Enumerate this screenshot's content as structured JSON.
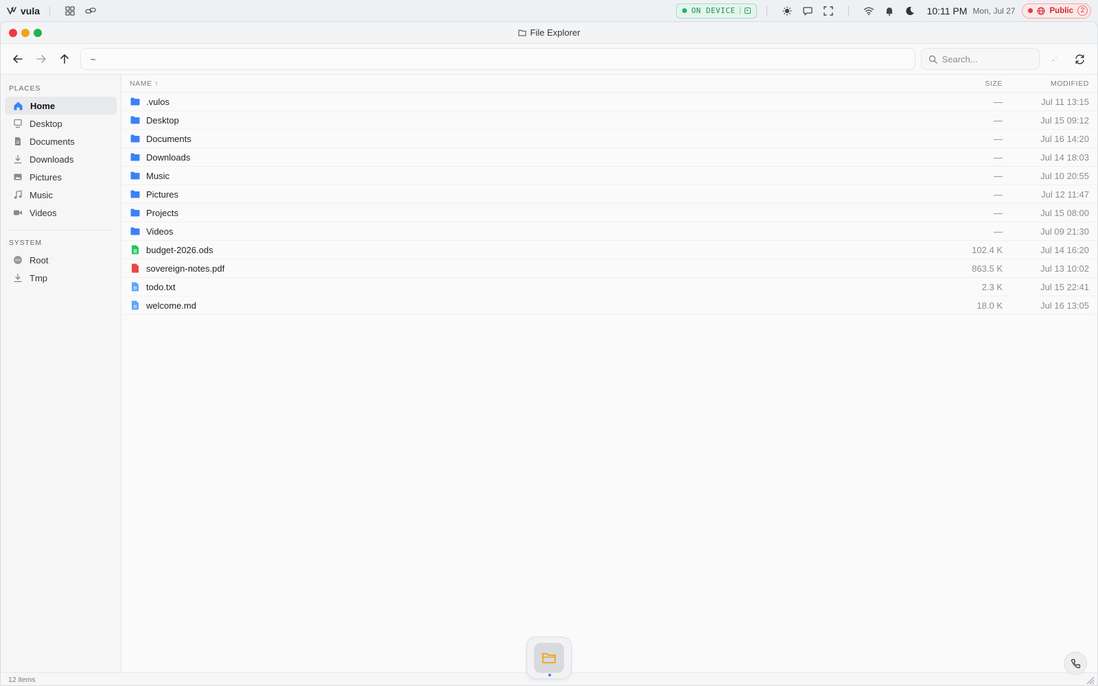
{
  "topbar": {
    "brand": "vula",
    "device_badge": "ON DEVICE",
    "time": "10:11 PM",
    "date": "Mon, Jul 27",
    "network_badge": "Public",
    "network_count": "2"
  },
  "window": {
    "title": "File Explorer"
  },
  "toolbar": {
    "path": "~",
    "search_placeholder": "Search..."
  },
  "sidebar": {
    "places_label": "PLACES",
    "places": [
      {
        "label": "Home",
        "icon": "home-icon"
      },
      {
        "label": "Desktop",
        "icon": "desktop-icon"
      },
      {
        "label": "Documents",
        "icon": "document-icon"
      },
      {
        "label": "Downloads",
        "icon": "download-icon"
      },
      {
        "label": "Pictures",
        "icon": "image-icon"
      },
      {
        "label": "Music",
        "icon": "music-icon"
      },
      {
        "label": "Videos",
        "icon": "video-icon"
      }
    ],
    "system_label": "SYSTEM",
    "system": [
      {
        "label": "Root",
        "icon": "root-icon"
      },
      {
        "label": "Tmp",
        "icon": "download-icon"
      }
    ]
  },
  "columns": {
    "name": "NAME ↑",
    "size": "SIZE",
    "modified": "MODIFIED"
  },
  "files": [
    {
      "name": ".vulos",
      "type": "folder",
      "size": "—",
      "modified": "Jul 11 13:15"
    },
    {
      "name": "Desktop",
      "type": "folder",
      "size": "—",
      "modified": "Jul 15 09:12"
    },
    {
      "name": "Documents",
      "type": "folder",
      "size": "—",
      "modified": "Jul 16 14:20"
    },
    {
      "name": "Downloads",
      "type": "folder",
      "size": "—",
      "modified": "Jul 14 18:03"
    },
    {
      "name": "Music",
      "type": "folder",
      "size": "—",
      "modified": "Jul 10 20:55"
    },
    {
      "name": "Pictures",
      "type": "folder",
      "size": "—",
      "modified": "Jul 12 11:47"
    },
    {
      "name": "Projects",
      "type": "folder",
      "size": "—",
      "modified": "Jul 15 08:00"
    },
    {
      "name": "Videos",
      "type": "folder",
      "size": "—",
      "modified": "Jul 09 21:30"
    },
    {
      "name": "budget-2026.ods",
      "type": "spreadsheet",
      "size": "102.4 K",
      "modified": "Jul 14 16:20"
    },
    {
      "name": "sovereign-notes.pdf",
      "type": "pdf",
      "size": "863.5 K",
      "modified": "Jul 13 10:02"
    },
    {
      "name": "todo.txt",
      "type": "text",
      "size": "2.3 K",
      "modified": "Jul 15 22:41"
    },
    {
      "name": "welcome.md",
      "type": "text",
      "size": "18.0 K",
      "modified": "Jul 16 13:05"
    }
  ],
  "status": {
    "item_count": "12 items"
  },
  "colors": {
    "folder": "#3b82f6",
    "spreadsheet": "#22c55e",
    "pdf": "#ef4444",
    "text": "#60a5fa",
    "accent": "#3b82f6"
  }
}
